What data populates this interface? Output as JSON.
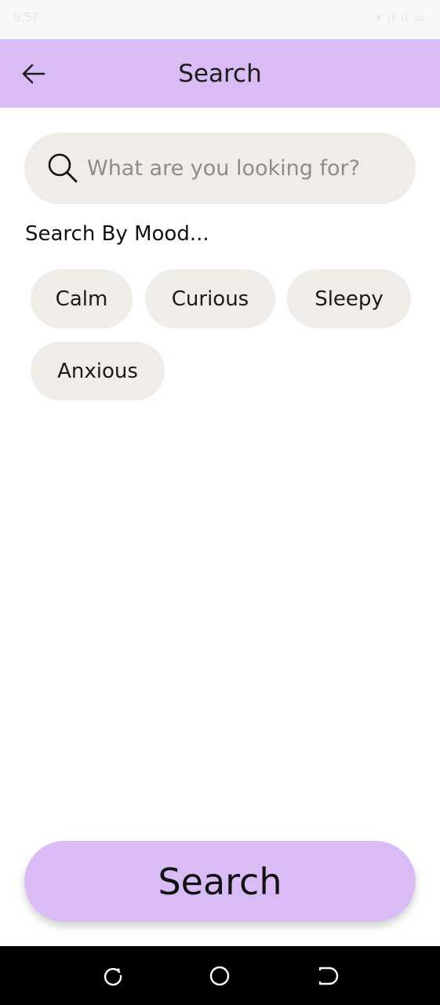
{
  "status_bar": {
    "time": "9:57",
    "indicators": "▾ ıl ıl ▭"
  },
  "app_bar": {
    "title": "Search",
    "back_icon": "arrow-left-icon"
  },
  "search": {
    "placeholder": "What are you looking for?",
    "value": "",
    "icon": "search-icon"
  },
  "mood": {
    "heading": "Search By Mood...",
    "chips": [
      "Calm",
      "Curious",
      "Sleepy",
      "Anxious"
    ]
  },
  "search_button": {
    "label": "Search"
  },
  "colors": {
    "accent": "#d9bcf6",
    "chip_bg": "#f0ede9",
    "nav_bar": "#000000"
  },
  "nav_bar": {
    "icons": [
      "recent-apps-icon",
      "home-icon",
      "back-icon"
    ]
  }
}
